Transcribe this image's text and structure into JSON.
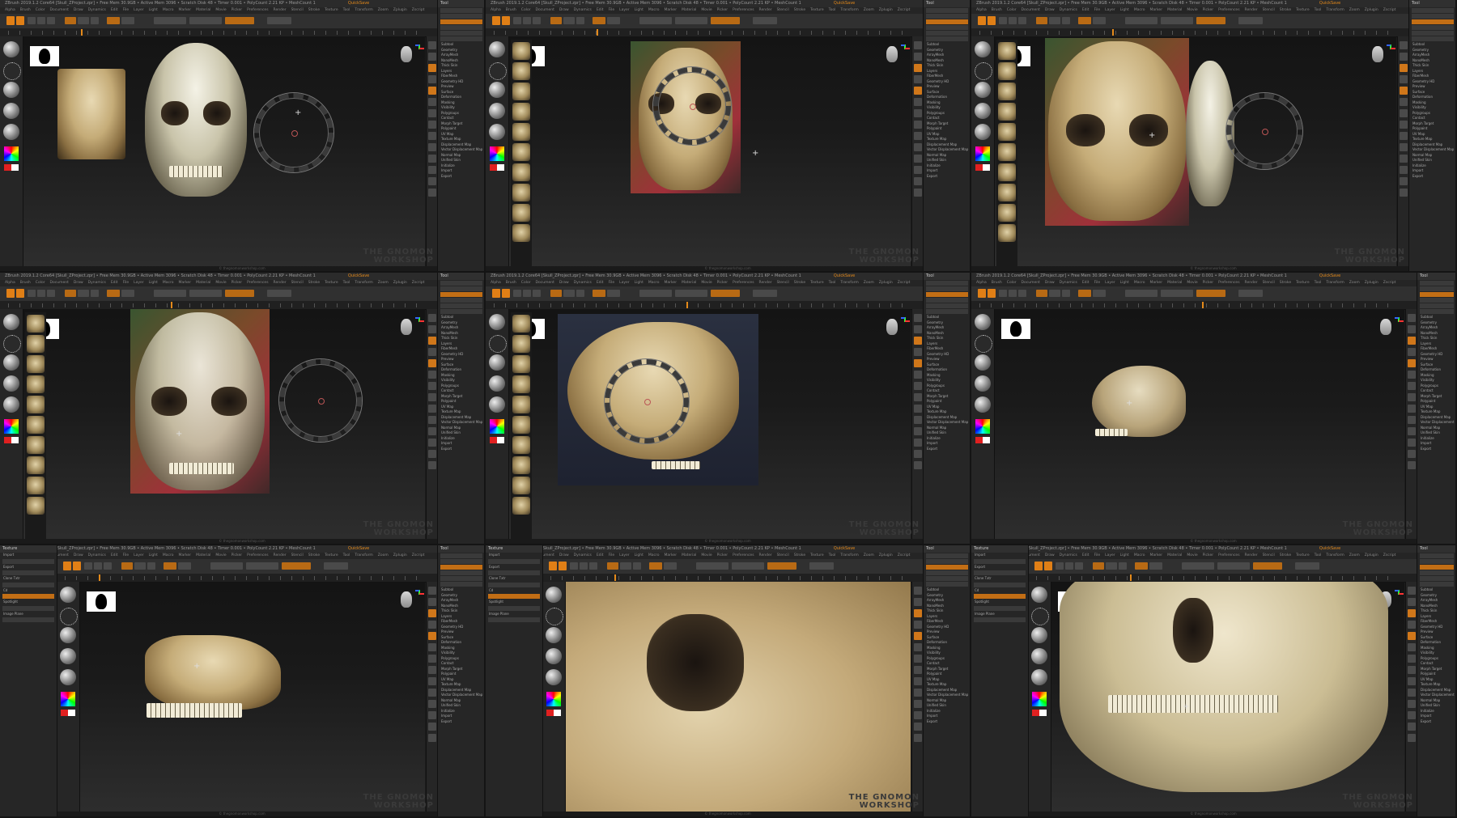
{
  "app": {
    "title_bar": "ZBrush 2019.1.2 Core64 [Skull_ZProject.zpr]  • Free Mem 30.9GB • Active Mem 3096 • Scratch Disk 48 • Timer 0.001 • PolyCount 2.21 KP • MeshCount 1",
    "mode_label": "QuickSave",
    "menu_items": [
      "Alpha",
      "Brush",
      "Color",
      "Document",
      "Draw",
      "Dynamics",
      "Edit",
      "File",
      "Layer",
      "Light",
      "Macro",
      "Marker",
      "Material",
      "Movie",
      "Picker",
      "Preferences",
      "Render",
      "Stencil",
      "Stroke",
      "Texture",
      "Tool",
      "Transform",
      "Zoom",
      "Zplugin",
      "Zscript"
    ],
    "toolbar": {
      "edit": "Edit",
      "draw": "Draw",
      "move": "Move",
      "scale": "Scale",
      "rotate": "Rotate",
      "mrgb": "Mrgb",
      "rgb": "Rgb",
      "m": "M",
      "zadd": "Zadd",
      "zsub": "Zsub",
      "focal_shift": "Focal Shift 0",
      "draw_size": "Draw Size 64",
      "z_intensity": "Z Intensity 25",
      "dynamic": "Dynamic"
    },
    "watermark_line1": "THE GNOMON",
    "watermark_line2": "WORKSHOP",
    "footer": "© thegnomonworkshop.com"
  },
  "tool_panel": {
    "title": "Tool",
    "items": [
      "Subtool",
      "Geometry",
      "ArrayMesh",
      "NanoMesh",
      "Thick Skin",
      "Layers",
      "FiberMesh",
      "Geometry HD",
      "Preview",
      "Surface",
      "Deformation",
      "Masking",
      "Visibility",
      "Polygroups",
      "Contact",
      "Morph Target",
      "Polypaint",
      "UV Map",
      "Texture Map",
      "Displacement Map",
      "Vector Displacement Map",
      "Normal Map",
      "Unified Skin",
      "Initialize",
      "Import",
      "Export"
    ]
  },
  "texture_panel": {
    "title": "Texture",
    "items": [
      "Import",
      "Export",
      "Clone Txtr",
      "Cd",
      "Spotlight",
      "Image Plane"
    ]
  },
  "icons": [
    "brush-icon",
    "stroke-icon",
    "alpha-icon",
    "texture-icon",
    "material-icon",
    "color-picker-icon",
    "mask-silhouette-icon",
    "head-orientation-icon",
    "gyro-icon",
    "spotlight-dial-icon",
    "cursor-cross-icon"
  ]
}
